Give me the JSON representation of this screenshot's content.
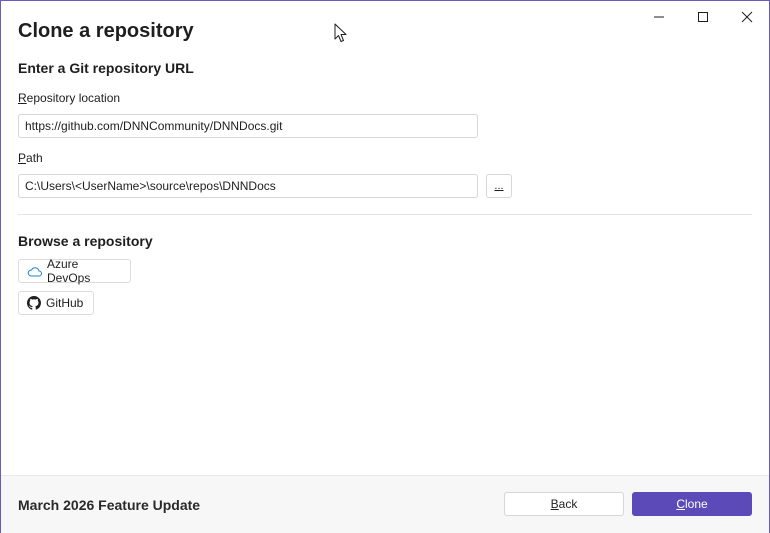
{
  "window": {
    "title": "Clone a repository",
    "controls": {
      "minimize_icon": "minimize-icon",
      "maximize_icon": "maximize-icon",
      "close_icon": "close-icon"
    }
  },
  "git_url_section": {
    "heading": "Enter a Git repository URL",
    "repository_location": {
      "label_access_key": "R",
      "label_rest": "epository location",
      "value": "https://github.com/DNNCommunity/DNNDocs.git"
    },
    "path": {
      "label_access_key": "P",
      "label_rest": "ath",
      "value": "C:\\Users\\<UserName>\\source\\repos\\DNNDocs",
      "browse_label": "..."
    }
  },
  "browse_section": {
    "heading": "Browse a repository",
    "providers": [
      {
        "label": "Azure DevOps",
        "icon": "cloud-icon"
      },
      {
        "label": "GitHub",
        "icon": "github-icon"
      }
    ]
  },
  "footer": {
    "version_text": "March 2026 Feature Update",
    "back": {
      "access_key": "B",
      "rest": "ack"
    },
    "clone": {
      "access_key": "C",
      "rest": "lone"
    }
  },
  "colors": {
    "accent": "#5b4ab8",
    "window_border": "#6a5bc0",
    "footer_background": "#f7f7f7"
  }
}
